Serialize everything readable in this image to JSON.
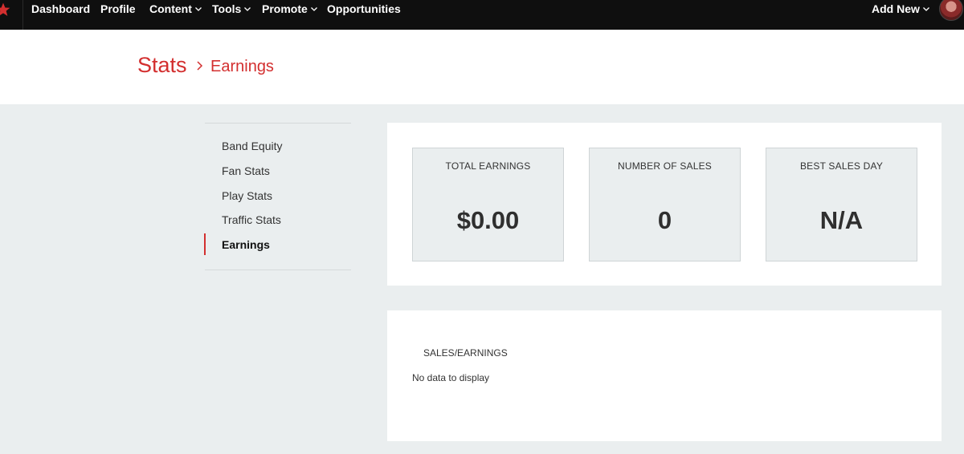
{
  "nav": {
    "items": [
      {
        "label": "Dashboard",
        "has_caret": false
      },
      {
        "label": "Profile",
        "has_caret": false
      },
      {
        "label": "Content",
        "has_caret": true
      },
      {
        "label": "Tools",
        "has_caret": true
      },
      {
        "label": "Promote",
        "has_caret": true
      },
      {
        "label": "Opportunities",
        "has_caret": false
      }
    ],
    "add_new_label": "Add New",
    "logo_icon": "star-icon",
    "brand_color": "#d32f2f"
  },
  "breadcrumb": {
    "root": "Stats",
    "current": "Earnings"
  },
  "sidebar": {
    "items": [
      {
        "label": "Band Equity",
        "active": false
      },
      {
        "label": "Fan Stats",
        "active": false
      },
      {
        "label": "Play Stats",
        "active": false
      },
      {
        "label": "Traffic Stats",
        "active": false
      },
      {
        "label": "Earnings",
        "active": true
      }
    ]
  },
  "stats": [
    {
      "label": "TOTAL EARNINGS",
      "value": "$0.00"
    },
    {
      "label": "NUMBER OF SALES",
      "value": "0"
    },
    {
      "label": "BEST SALES DAY",
      "value": "N/A"
    }
  ],
  "chart": {
    "title": "SALES/EARNINGS",
    "empty_message": "No data to display"
  }
}
